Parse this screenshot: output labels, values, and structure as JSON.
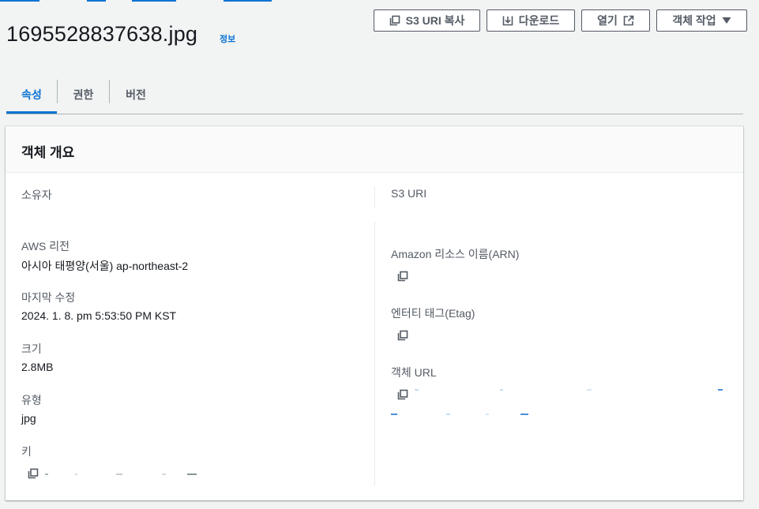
{
  "object": {
    "name": "1695528837638.jpg",
    "info_label": "정보"
  },
  "toolbar": {
    "copy_uri_label": "S3 URI 복사",
    "download_label": "다운로드",
    "open_label": "열기",
    "actions_label": "객체 작업"
  },
  "tabs": [
    {
      "label": "속성",
      "active": true
    },
    {
      "label": "권한",
      "active": false
    },
    {
      "label": "버전",
      "active": false
    }
  ],
  "overview": {
    "title": "객체 개요",
    "owner": {
      "label": "소유자"
    },
    "region": {
      "label": "AWS 리전",
      "value": "아시아 태평양(서울) ap-northeast-2"
    },
    "last_modified": {
      "label": "마지막 수정",
      "value": "2024. 1. 8. pm 5:53:50 PM KST"
    },
    "size": {
      "label": "크기",
      "value": "2.8MB"
    },
    "type": {
      "label": "유형",
      "value": "jpg"
    },
    "key": {
      "label": "키"
    },
    "s3_uri": {
      "label": "S3 URI"
    },
    "arn": {
      "label": "Amazon 리소스 이름(ARN)"
    },
    "etag": {
      "label": "엔터티 태그(Etag)"
    },
    "object_url": {
      "label": "객체 URL"
    }
  },
  "colors": {
    "accent": "#0972d3",
    "text": "#16191f",
    "label": "#545b64",
    "background": "#f2f3f3"
  },
  "icons": [
    "copy-icon",
    "download-icon",
    "external-link-icon",
    "caret-down-icon"
  ]
}
